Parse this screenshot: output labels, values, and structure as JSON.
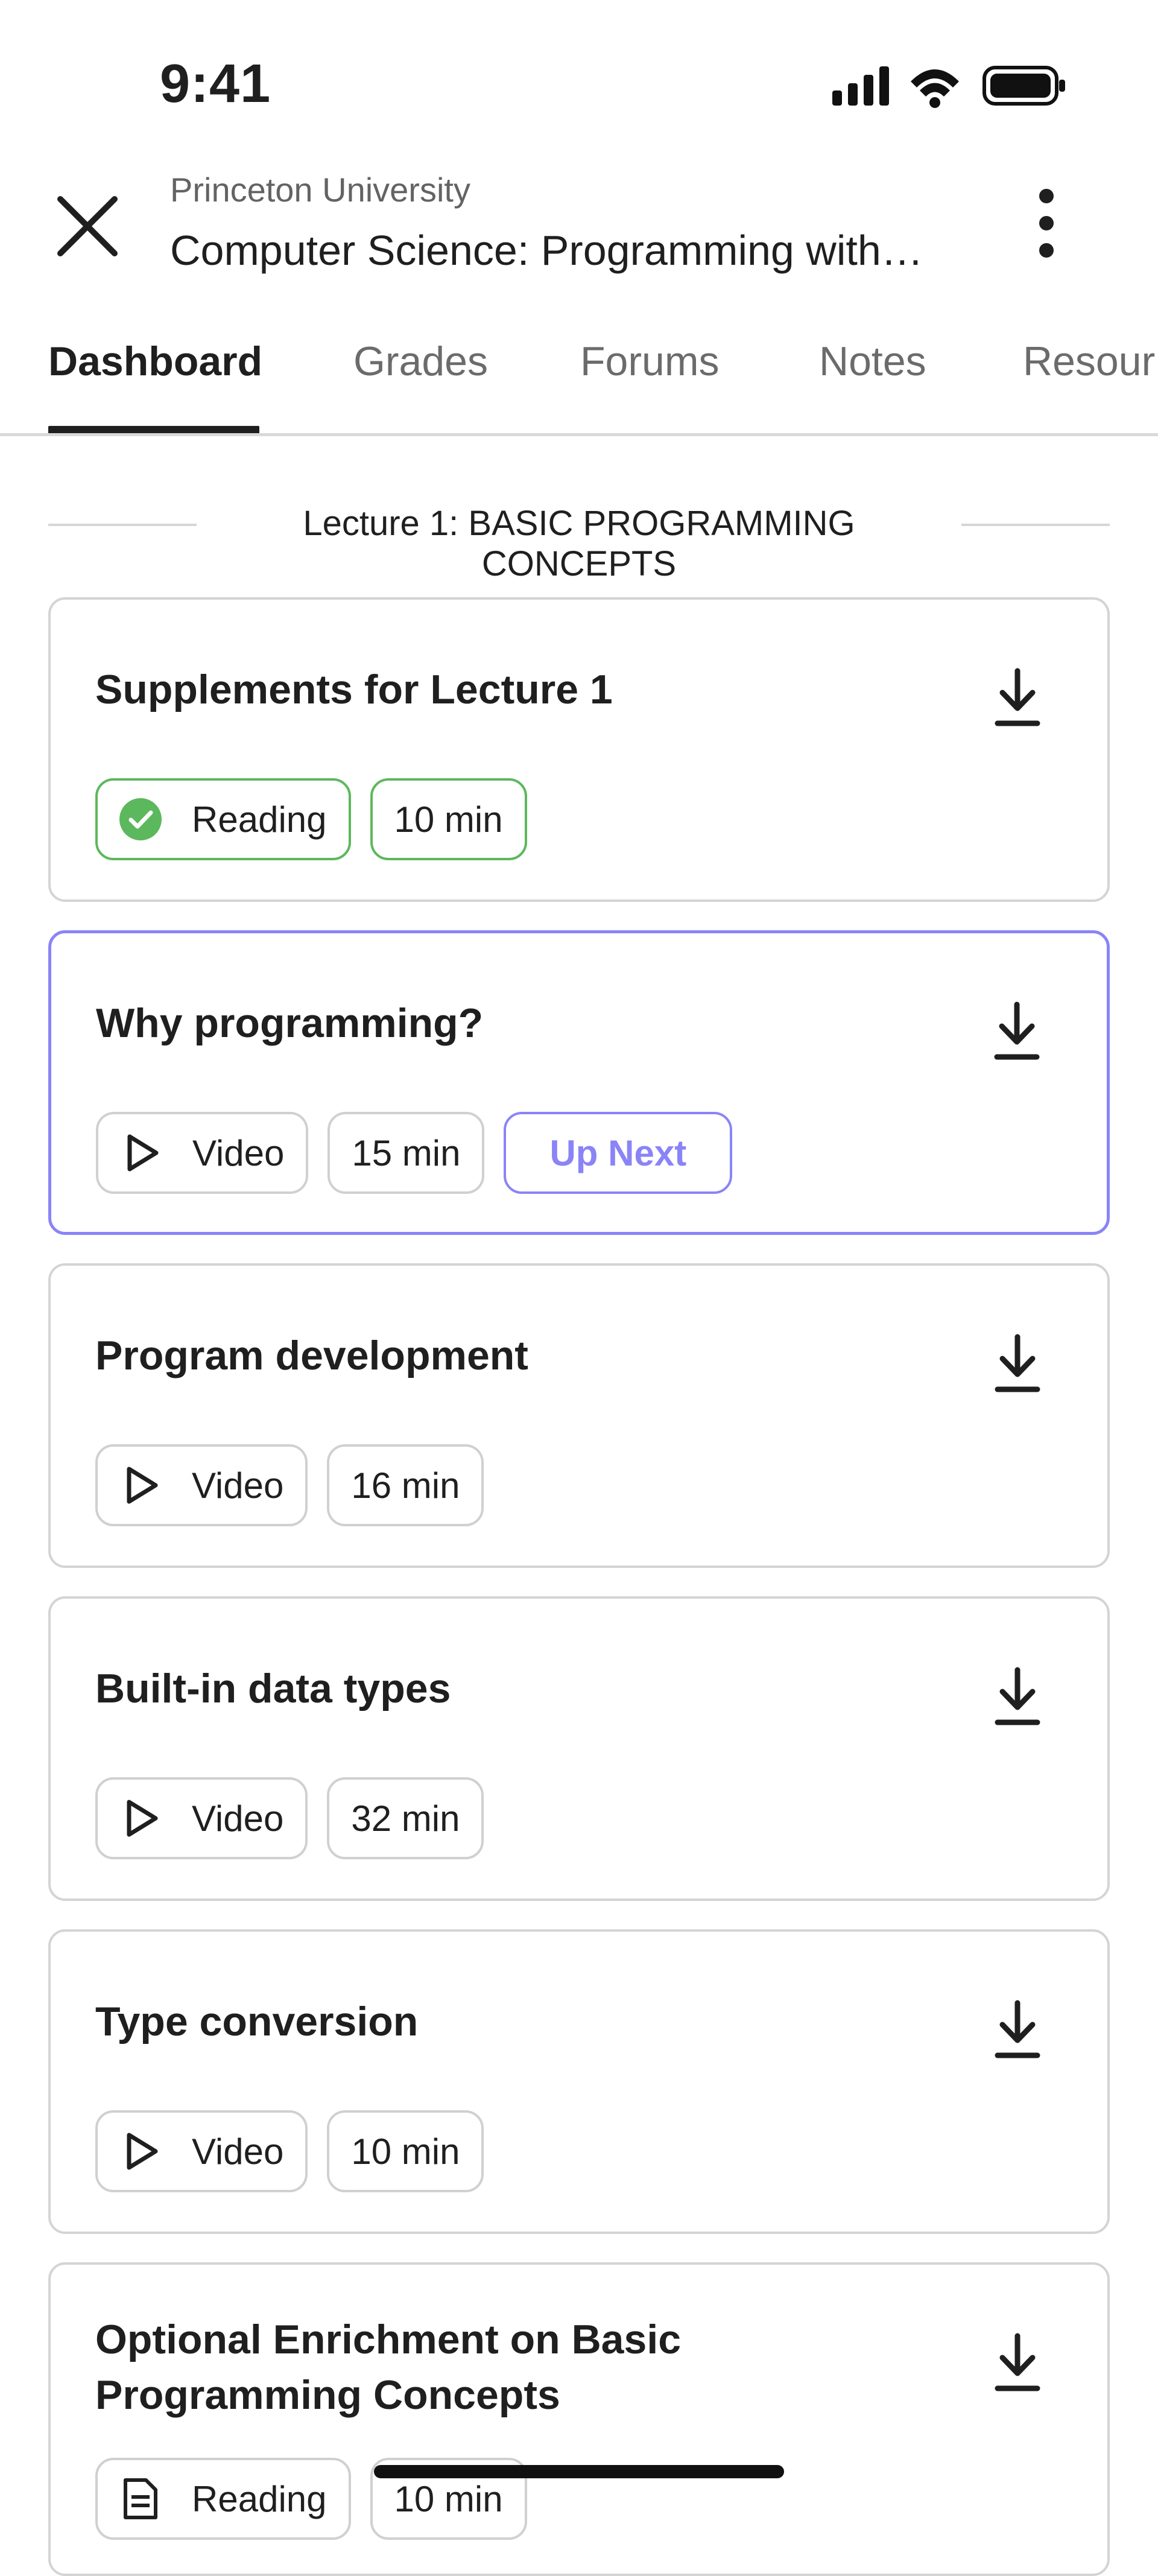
{
  "status_bar": {
    "time": "9:41"
  },
  "header": {
    "organization": "Princeton University",
    "course_title": "Computer Science: Programming with…"
  },
  "tabs": [
    {
      "label": "Dashboard",
      "active": true
    },
    {
      "label": "Grades"
    },
    {
      "label": "Forums"
    },
    {
      "label": "Notes"
    },
    {
      "label": "Resour"
    }
  ],
  "section": {
    "title": "Lecture 1: BASIC PROGRAMMING CONCEPTS"
  },
  "items": [
    {
      "title": "Supplements for Lecture 1",
      "type": "Reading",
      "duration": "10 min",
      "completed": true
    },
    {
      "title": "Why programming?",
      "type": "Video",
      "duration": "15 min",
      "badge": "Up Next"
    },
    {
      "title": "Program development",
      "type": "Video",
      "duration": "16 min"
    },
    {
      "title": "Built-in data types",
      "type": "Video",
      "duration": "32 min"
    },
    {
      "title": "Type conversion",
      "type": "Video",
      "duration": "10 min"
    },
    {
      "title_line1": "Optional Enrichment on Basic",
      "title_line2": "Programming Concepts",
      "type": "Reading",
      "duration": "10 min"
    }
  ],
  "colors": {
    "accent": "#8a84f7",
    "success": "#5cb85c",
    "border": "#d4d4d4",
    "text": "#1f1f1f"
  },
  "icons": [
    "signal-icon",
    "wifi-icon",
    "battery-icon",
    "close-icon",
    "more-vertical-icon",
    "download-icon",
    "check-circle-icon",
    "play-icon",
    "document-icon"
  ]
}
